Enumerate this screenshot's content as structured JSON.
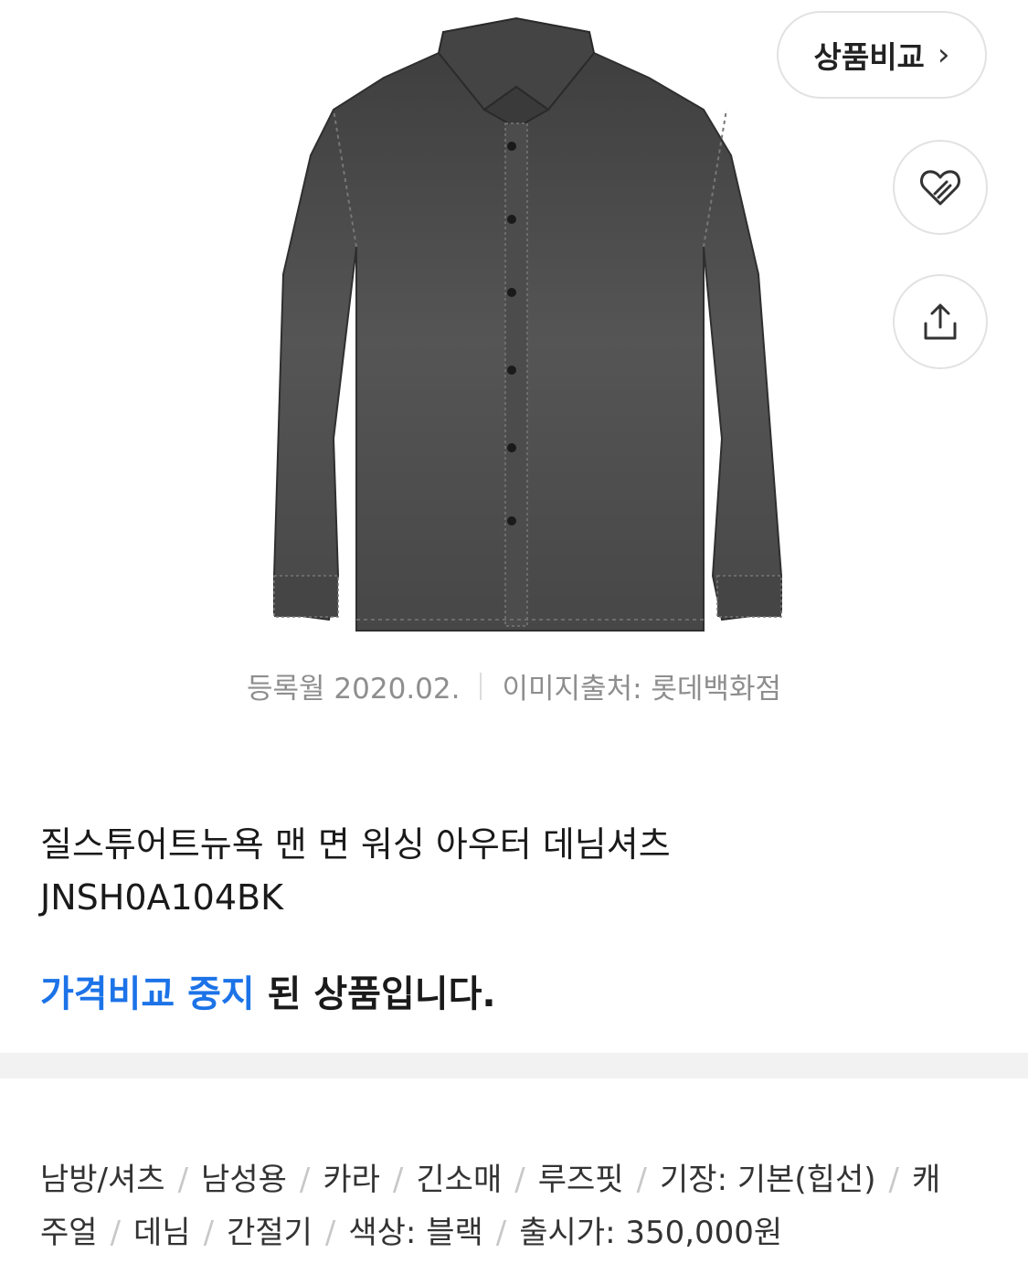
{
  "header": {
    "compare_label": "상품비교",
    "compare_chevron": "›",
    "wish_icon": "heart-icon",
    "share_icon": "share-icon"
  },
  "image": {
    "alt": "질스튜어트뉴욕 맨 면 워싱 아우터 데님셔츠 JNSH0A104BK",
    "registered": "등록월 2020.02.",
    "source": "이미지출처: 롯데백화점"
  },
  "product": {
    "title_line1": "질스튜어트뉴욕 맨 면 워싱 아우터 데님셔츠",
    "title_line2": "JNSH0A104BK",
    "notice_highlight": "가격비교 중지",
    "notice_rest": " 된 상품입니다."
  },
  "specs": {
    "row1": [
      "남방/셔츠",
      "남성용",
      "카라",
      "긴소매",
      "루즈핏",
      "기장: 기본(힙선)",
      "캐"
    ],
    "row2": [
      "주얼",
      "데님",
      "간절기",
      "색상: 블랙",
      "출시가: 350,000원"
    ]
  },
  "colors": {
    "accent": "#1c73e8",
    "shirt": "#4a4a4a"
  }
}
